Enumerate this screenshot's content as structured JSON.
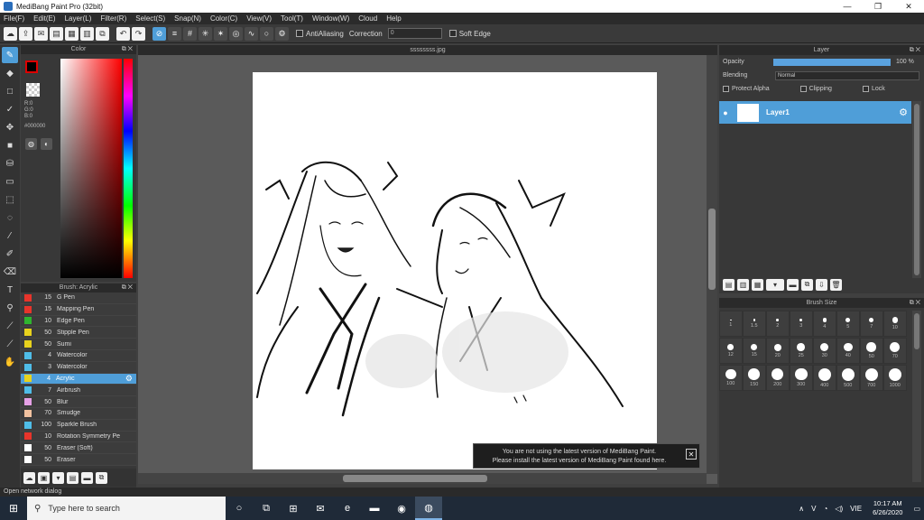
{
  "window": {
    "title": "MediBang Paint Pro (32bit)"
  },
  "menu": [
    "File(F)",
    "Edit(E)",
    "Layer(L)",
    "Filter(R)",
    "Select(S)",
    "Snap(N)",
    "Color(C)",
    "View(V)",
    "Tool(T)",
    "Window(W)",
    "Cloud",
    "Help"
  ],
  "toolbar": {
    "antialiasing_label": "AntiAliasing",
    "correction_label": "Correction",
    "correction_value": "0",
    "soft_edge_label": "Soft Edge"
  },
  "color_panel": {
    "title": "Color",
    "rgb": [
      "R:0",
      "G:0",
      "B:0"
    ],
    "hex": "#000000",
    "foreground": "#000000"
  },
  "brush_panel": {
    "title": "Brush: Acrylic",
    "items": [
      {
        "size": "15",
        "name": "G Pen",
        "color": "#e8342b"
      },
      {
        "size": "15",
        "name": "Mapping Pen",
        "color": "#e8342b"
      },
      {
        "size": "10",
        "name": "Edge Pen",
        "color": "#2fb52f"
      },
      {
        "size": "50",
        "name": "Stipple Pen",
        "color": "#e8d21d"
      },
      {
        "size": "50",
        "name": "Sumi",
        "color": "#e8d21d"
      },
      {
        "size": "4",
        "name": "Watercolor",
        "color": "#4fbde8"
      },
      {
        "size": "3",
        "name": "Watercolor",
        "color": "#4fbde8"
      },
      {
        "size": "4",
        "name": "Acrylic",
        "color": "#e8d21d",
        "selected": true
      },
      {
        "size": "7",
        "name": "Airbrush",
        "color": "#4fbde8"
      },
      {
        "size": "50",
        "name": "Blur",
        "color": "#e6a0e6"
      },
      {
        "size": "70",
        "name": "Smudge",
        "color": "#f2c2a0"
      },
      {
        "size": "100",
        "name": "Sparkle Brush",
        "color": "#4fbde8"
      },
      {
        "size": "10",
        "name": "Rotation Symmetry Pe",
        "color": "#e8342b"
      },
      {
        "size": "50",
        "name": "Eraser (Soft)",
        "color": "#ffffff"
      },
      {
        "size": "50",
        "name": "Eraser",
        "color": "#ffffff"
      }
    ]
  },
  "canvas": {
    "tab": "ssssssss.jpg"
  },
  "notice": {
    "line1": "You are not using the latest version of MediBang Paint.",
    "line2": "Please install the latest version of MediBang Paint found here."
  },
  "layer_panel": {
    "title": "Layer",
    "opacity_label": "Opacity",
    "opacity_value": "100 %",
    "opacity": 1.0,
    "blending_label": "Blending",
    "blending_value": "Normal",
    "protect_alpha": "Protect Alpha",
    "clipping": "Clipping",
    "lock": "Lock",
    "layers": [
      {
        "name": "Layer1",
        "visible": true
      }
    ]
  },
  "brush_size": {
    "title": "Brush Size",
    "sizes": [
      "1",
      "1.5",
      "2",
      "3",
      "4",
      "5",
      "7",
      "10",
      "12",
      "15",
      "20",
      "25",
      "30",
      "40",
      "50",
      "70",
      "100",
      "150",
      "200",
      "300",
      "400",
      "500",
      "700",
      "1000"
    ]
  },
  "status": {
    "text": "Open network dialog"
  },
  "taskbar": {
    "search_placeholder": "Type here to search",
    "lang": "VIE",
    "time": "10:17 AM",
    "date": "6/26/2020"
  }
}
